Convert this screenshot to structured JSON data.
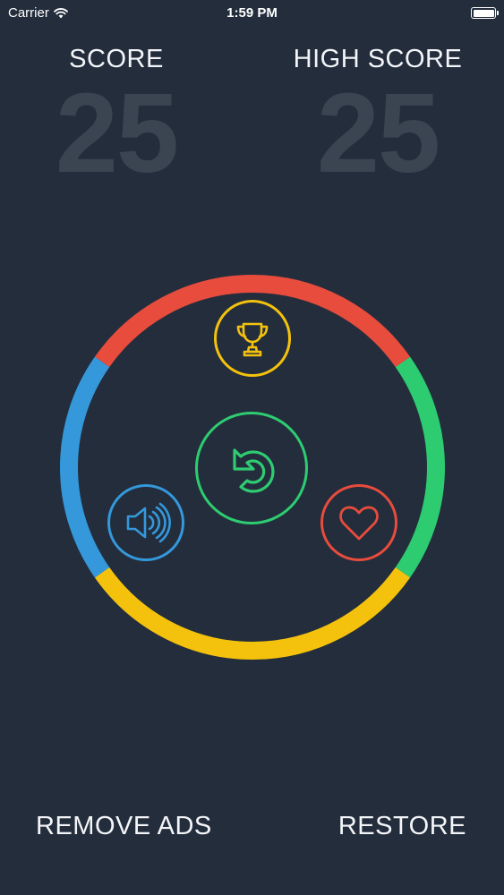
{
  "status_bar": {
    "carrier": "Carrier",
    "time": "1:59 PM",
    "battery_level": 1.0
  },
  "score": {
    "label": "SCORE",
    "value": "25"
  },
  "high_score": {
    "label": "HIGH SCORE",
    "value": "25"
  },
  "ring": {
    "segments": [
      {
        "name": "red",
        "color": "#e74c3c"
      },
      {
        "name": "green",
        "color": "#2ecc71"
      },
      {
        "name": "yellow",
        "color": "#f4c20d"
      },
      {
        "name": "blue",
        "color": "#3498db"
      }
    ]
  },
  "buttons": {
    "leaderboard": {
      "icon": "trophy-icon",
      "color": "#f4c20d"
    },
    "replay": {
      "icon": "replay-icon",
      "color": "#2ecc71"
    },
    "sound": {
      "icon": "speaker-icon",
      "color": "#3498db"
    },
    "like": {
      "icon": "heart-icon",
      "color": "#e74c3c"
    }
  },
  "footer": {
    "remove_ads": "REMOVE ADS",
    "restore": "RESTORE"
  },
  "colors": {
    "background": "#232d3c",
    "score_digits": "#3b4552",
    "text": "#f3f5f8"
  }
}
